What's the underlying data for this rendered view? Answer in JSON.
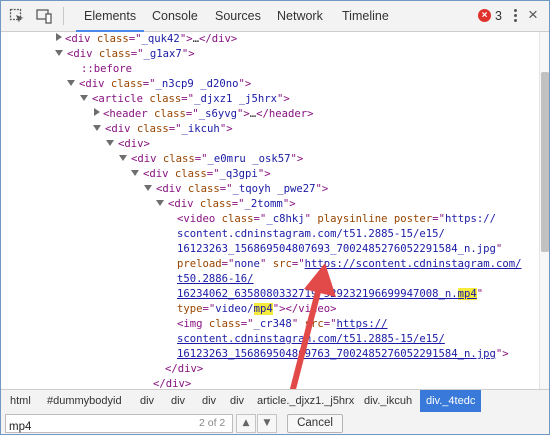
{
  "toolbar": {
    "tabs": [
      {
        "label": "Elements",
        "active": true
      },
      {
        "label": "Console"
      },
      {
        "label": "Sources"
      },
      {
        "label": "Network"
      },
      {
        "label": "Timeline"
      }
    ],
    "error_badge_icon": "error-x-icon",
    "error_count": "3",
    "accent_color": "#4b86e8",
    "error_color": "#e0322c"
  },
  "tree": {
    "l1": {
      "tag_open": "<div ",
      "attr": "class",
      "eq": "=\"",
      "val": "_quk42",
      "close": "\">",
      "ellipsis": "…",
      "end_tag": "</div>"
    },
    "l2": {
      "tag_open": "<div ",
      "attr": "class",
      "eq": "=\"",
      "val": "_g1ax7",
      "close": "\">"
    },
    "l3": {
      "text": "::before"
    },
    "l4": {
      "tag_open": "<div ",
      "attr": "class",
      "eq": "=\"",
      "val": "_n3cp9 _d20no",
      "close": "\">"
    },
    "l5": {
      "tag_open": "<article ",
      "attr": "class",
      "eq": "=\"",
      "val": "_djxz1 _j5hrx",
      "close": "\">"
    },
    "l6": {
      "tag_open": "<header ",
      "attr": "class",
      "eq": "=\"",
      "val": "_s6yvg",
      "close": "\">",
      "ellipsis": "…",
      "end_tag": "</header>"
    },
    "l7": {
      "tag_open": "<div ",
      "attr": "class",
      "eq": "=\"",
      "val": "_ikcuh",
      "close": "\">"
    },
    "l8": {
      "tag": "<div>"
    },
    "l9": {
      "tag_open": "<div ",
      "attr": "class",
      "eq": "=\"",
      "val": "_e0mru _osk57",
      "close": "\">"
    },
    "l10": {
      "tag_open": "<div ",
      "attr": "class",
      "eq": "=\"",
      "val": "_q3gpi",
      "close": "\">"
    },
    "l11": {
      "tag_open": "<div ",
      "attr": "class",
      "eq": "=\"",
      "val": "_tqoyh _pwe27",
      "close": "\">"
    },
    "l12": {
      "tag_open": "<div ",
      "attr": "class",
      "eq": "=\"",
      "val": "_2tomm",
      "close": "\">"
    },
    "video": {
      "tag_open": "<video ",
      "a1": "class",
      "v1": "_c8hkj",
      "a2": "playsinline",
      "a3": "poster",
      "poster_1": "https://",
      "poster_2": "scontent.cdninstagram.com/t51.2885-15/e15/",
      "poster_3": "16123263_1568695048",
      "poster_3b": "07693_700248527605229",
      "poster_3c": "1584_n.jpg",
      "a4": "preload",
      "v4": "none",
      "a5": "src",
      "src_1": "https://scontent.cdninstagram.com/",
      "src_2": "t50.2886-16/",
      "src_3a": "16234062_63580803327",
      "src_3b": "19_529232196699947008_n.",
      "src_3c": "mp4",
      "a6": "type",
      "v6a": "video/",
      "v6b": "mp4",
      "end_tag": "</video>"
    },
    "img": {
      "tag_open": "<img ",
      "a1": "class",
      "v1": "_cr348",
      "a2": "src",
      "src_1": "https://",
      "src_2": "scontent.cdninstagram.com/t51.2885-15/e15/",
      "src_3a": "16123263_1568695048",
      "src_3b": "69763_700248527605229",
      "src_3c": "1584_n.jpg",
      "close": "\">"
    },
    "close_div_1": "</div>",
    "close_div_2": "</div>"
  },
  "breadcrumb": {
    "items": [
      "html",
      "#dummybodyid",
      "div",
      "div",
      "div",
      "div",
      "article._djxz1._j5hrx",
      "div._ikcuh",
      "div._4tedc"
    ],
    "selected_index": 8
  },
  "search": {
    "value": "mp4",
    "count": "2 of 2",
    "prev_icon": "chevron-up-icon",
    "next_icon": "chevron-down-icon",
    "cancel_label": "Cancel"
  },
  "annotation": {
    "color": "#e24a4a",
    "shape": "arrow-up"
  }
}
